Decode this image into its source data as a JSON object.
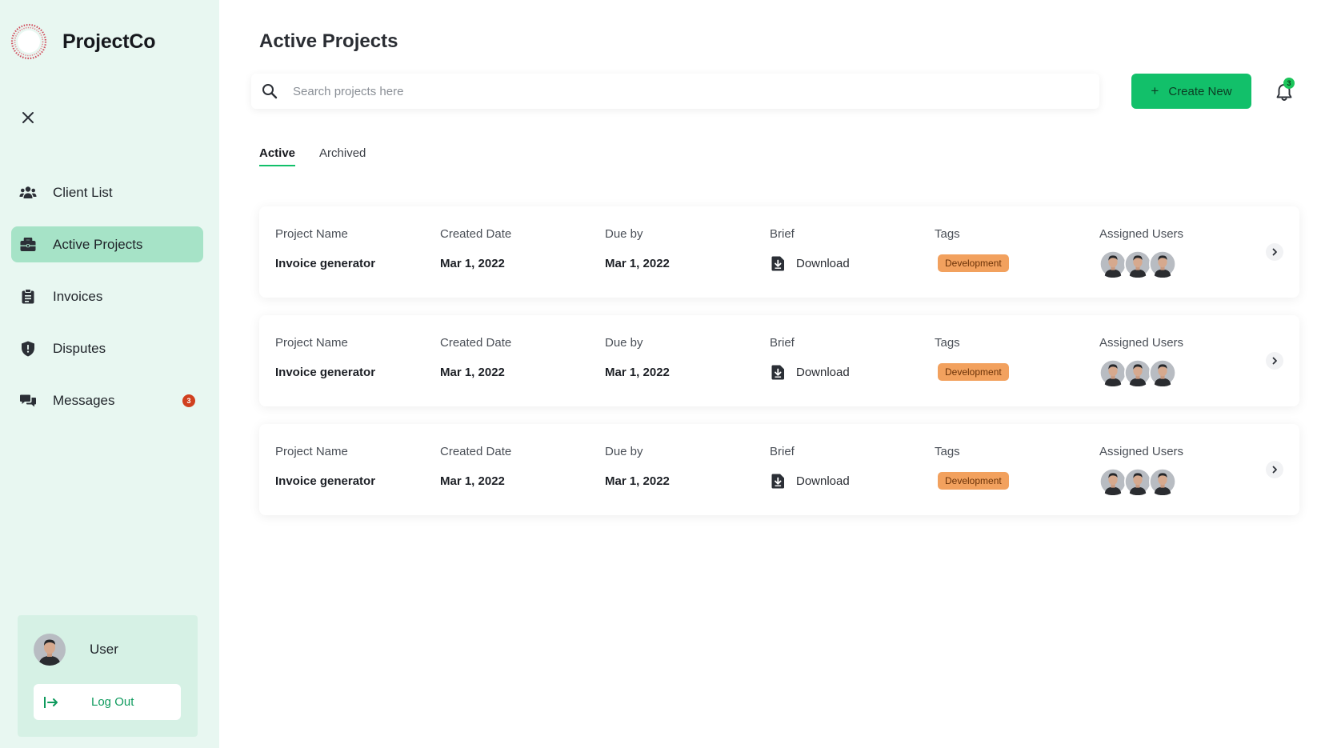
{
  "brand": {
    "name": "ProjectCo"
  },
  "sidebar": {
    "items": [
      {
        "label": "Client List",
        "icon": "users-icon"
      },
      {
        "label": "Active Projects",
        "icon": "briefcase-icon",
        "active": true
      },
      {
        "label": "Invoices",
        "icon": "clipboard-icon"
      },
      {
        "label": "Disputes",
        "icon": "shield-icon"
      },
      {
        "label": "Messages",
        "icon": "chat-icon",
        "badge": "3"
      }
    ]
  },
  "user": {
    "name": "User",
    "logout_label": "Log Out"
  },
  "main": {
    "title": "Active Projects",
    "search": {
      "placeholder": "Search projects here",
      "value": ""
    },
    "create_button": {
      "plus": "+",
      "label": "Create New"
    },
    "notifications": {
      "count": "3"
    },
    "tabs": [
      {
        "label": "Active",
        "active": true
      },
      {
        "label": "Archived",
        "active": false
      }
    ],
    "columns": {
      "name": "Project Name",
      "created": "Created Date",
      "due": "Due by",
      "brief": "Brief",
      "tags": "Tags",
      "users": "Assigned Users"
    },
    "projects": [
      {
        "name": "Invoice generator",
        "created": "Mar 1, 2022",
        "due": "Mar 1, 2022",
        "brief": "Download",
        "tag": "Development"
      },
      {
        "name": "Invoice generator",
        "created": "Mar 1, 2022",
        "due": "Mar 1, 2022",
        "brief": "Download",
        "tag": "Development"
      },
      {
        "name": "Invoice generator",
        "created": "Mar 1, 2022",
        "due": "Mar 1, 2022",
        "brief": "Download",
        "tag": "Development"
      }
    ]
  },
  "colors": {
    "sidebar_bg": "#e8f7f1",
    "active_item": "#a6e3c7",
    "accent_green": "#12c06a",
    "tag_orange": "#f2a15e",
    "badge_red": "#d0401f"
  }
}
